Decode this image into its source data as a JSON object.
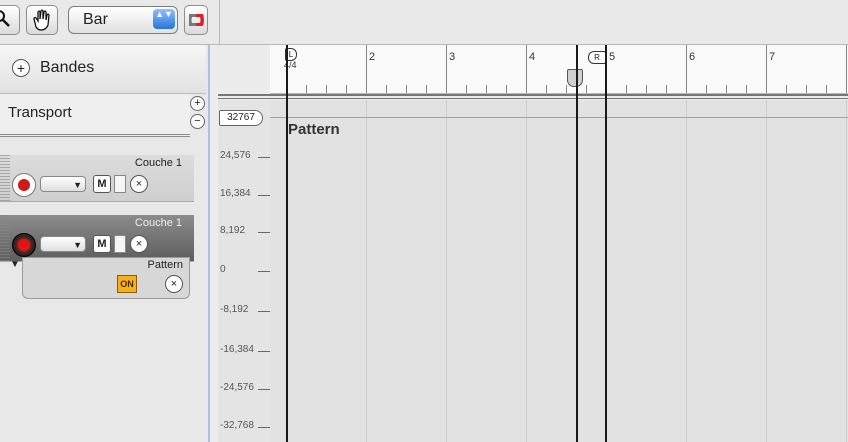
{
  "toolbar": {
    "snap_value": "Bar",
    "snap_arrows": "▲▼",
    "tools": [
      "zoom-tool",
      "hand-tool",
      "magnet-tool"
    ]
  },
  "tracks_panel": {
    "add_label": "Bandes",
    "add_symbol": "+",
    "transport_label": "Transport",
    "zoom_in": "+",
    "zoom_out": "−",
    "tracks": [
      {
        "name": "Couche 1",
        "mute": "M",
        "close": "×",
        "selected": false
      },
      {
        "name": "Couche 1",
        "mute": "M",
        "close": "×",
        "selected": true
      }
    ],
    "pattern": {
      "name": "Pattern",
      "on_label": "ON",
      "close": "×",
      "disclosure": "▼"
    }
  },
  "ruler": {
    "bars": [
      "2",
      "3",
      "4",
      "5",
      "6",
      "7"
    ],
    "time_signature": "4/4",
    "left_locator": "L",
    "right_locator": "R"
  },
  "lane": {
    "title": "Pattern",
    "max_value": "32767",
    "scale": [
      "24,576",
      "16,384",
      "8,192",
      "0",
      "-8,192",
      "-16,384",
      "-24,576",
      "-32,768"
    ]
  },
  "colors": {
    "record": "#d21919",
    "on_button": "#f6b01e",
    "select_blue": "#2a74d8",
    "lane_line": "#8aa6cc"
  }
}
